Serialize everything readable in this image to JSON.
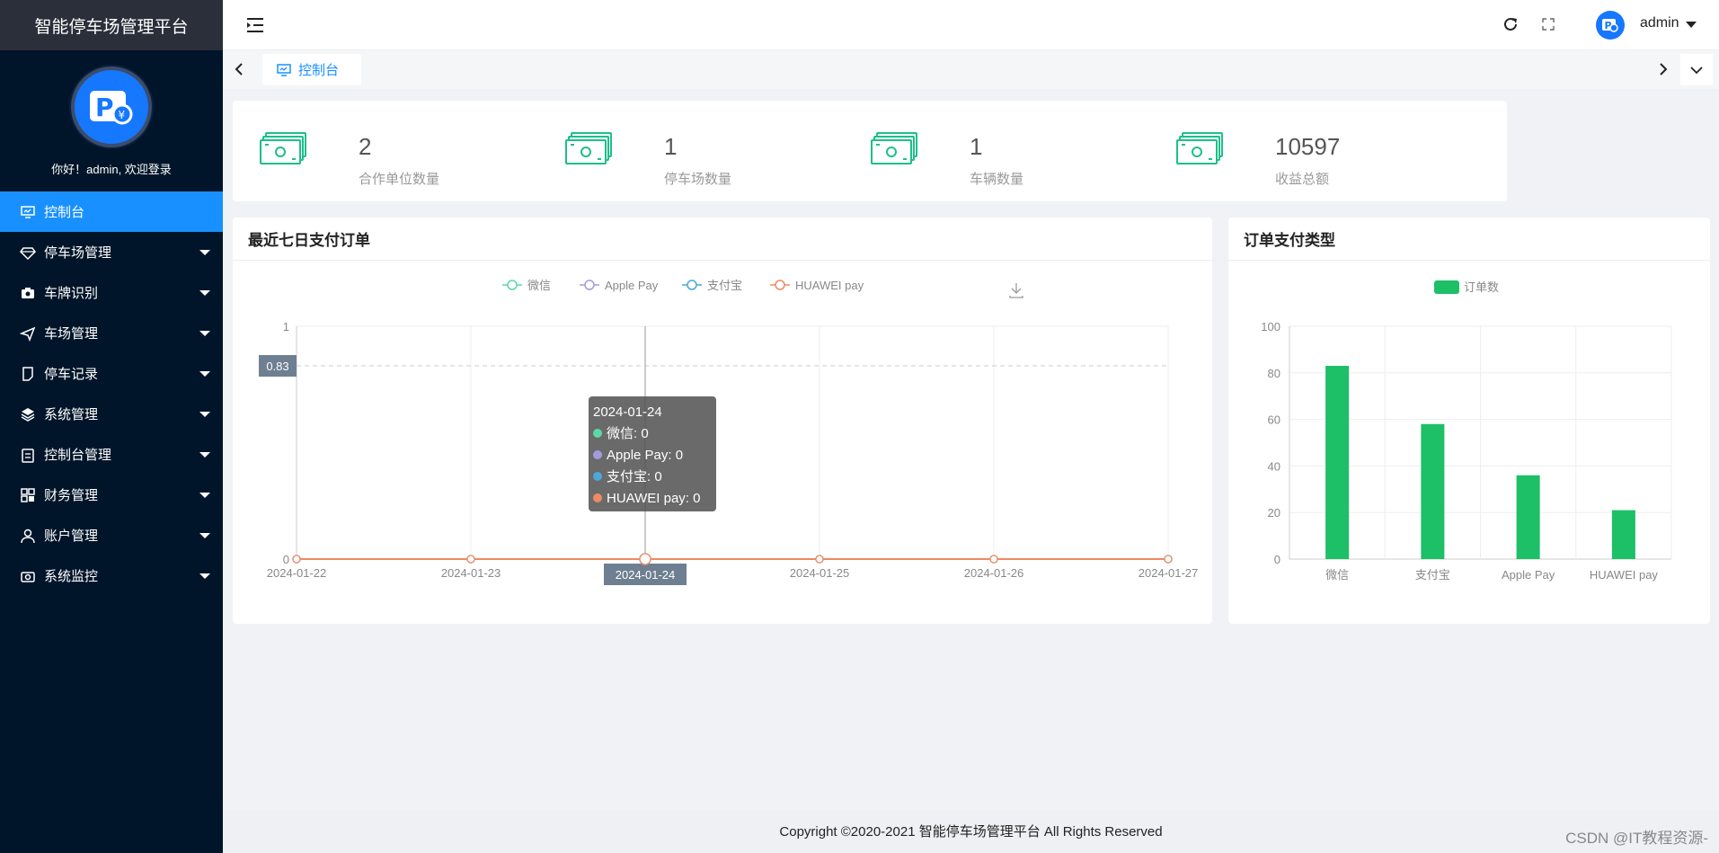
{
  "app": {
    "title": "智能停车场管理平台",
    "welcome": "你好！admin, 欢迎登录",
    "avatar_text": "P"
  },
  "sidebar": {
    "items": [
      {
        "label": "控制台",
        "icon": "monitor-icon",
        "active": true
      },
      {
        "label": "停车场管理",
        "icon": "diamond-icon"
      },
      {
        "label": "车牌识别",
        "icon": "camera-icon"
      },
      {
        "label": "车场管理",
        "icon": "send-icon"
      },
      {
        "label": "停车记录",
        "icon": "note-icon"
      },
      {
        "label": "系统管理",
        "icon": "layers-icon"
      },
      {
        "label": "控制台管理",
        "icon": "clipboard-icon"
      },
      {
        "label": "财务管理",
        "icon": "grid-icon"
      },
      {
        "label": "账户管理",
        "icon": "user-icon"
      },
      {
        "label": "系统监控",
        "icon": "camera2-icon"
      }
    ]
  },
  "topbar": {
    "user": "admin"
  },
  "tabs": [
    {
      "label": "控制台"
    }
  ],
  "stats": [
    {
      "value": "2",
      "label": "合作单位数量"
    },
    {
      "value": "1",
      "label": "停车场数量"
    },
    {
      "value": "1",
      "label": "车辆数量"
    },
    {
      "value": "10597",
      "label": "收益总额"
    }
  ],
  "panels": {
    "line_title": "最近七日支付订单",
    "bar_title": "订单支付类型"
  },
  "tooltip": {
    "date": "2024-01-24",
    "rows": [
      {
        "text": "微信: 0",
        "color": "#5bd8a6"
      },
      {
        "text": "Apple Pay: 0",
        "color": "#a29bde"
      },
      {
        "text": "支付宝: 0",
        "color": "#4ba8d8"
      },
      {
        "text": "HUAWEI pay: 0",
        "color": "#ef8a62"
      }
    ]
  },
  "axis_pointer": {
    "y_label": "0.83",
    "x_label": "2024-01-24"
  },
  "chart_data": [
    {
      "type": "line",
      "x": [
        "2024-01-22",
        "2024-01-23",
        "2024-01-24",
        "2024-01-25",
        "2024-01-26",
        "2024-01-27"
      ],
      "ylim": [
        0,
        1
      ],
      "yticks": [
        "0",
        "1"
      ],
      "legend_position": "top",
      "series": [
        {
          "name": "微信",
          "color": "#5bd8a6",
          "values": [
            0,
            0,
            0,
            0,
            0,
            0
          ]
        },
        {
          "name": "Apple Pay",
          "color": "#a29bde",
          "values": [
            0,
            0,
            0,
            0,
            0,
            0
          ]
        },
        {
          "name": "支付宝",
          "color": "#4ba8d8",
          "values": [
            0,
            0,
            0,
            0,
            0,
            0
          ]
        },
        {
          "name": "HUAWEI pay",
          "color": "#ef8a62",
          "values": [
            0,
            0,
            0,
            0,
            0,
            0
          ]
        }
      ]
    },
    {
      "type": "bar",
      "categories": [
        "微信",
        "支付宝",
        "Apple Pay",
        "HUAWEI pay"
      ],
      "ylim": [
        0,
        100
      ],
      "yticks": [
        "0",
        "20",
        "40",
        "60",
        "80",
        "100"
      ],
      "legend_position": "top",
      "series": [
        {
          "name": "订单数",
          "color": "#1dbf67",
          "values": [
            83,
            58,
            36,
            21
          ]
        }
      ]
    }
  ],
  "footer": {
    "text": "Copyright ©2020-2021 智能停车场管理平台 All Rights Reserved"
  },
  "watermark": "CSDN @IT教程资源-"
}
